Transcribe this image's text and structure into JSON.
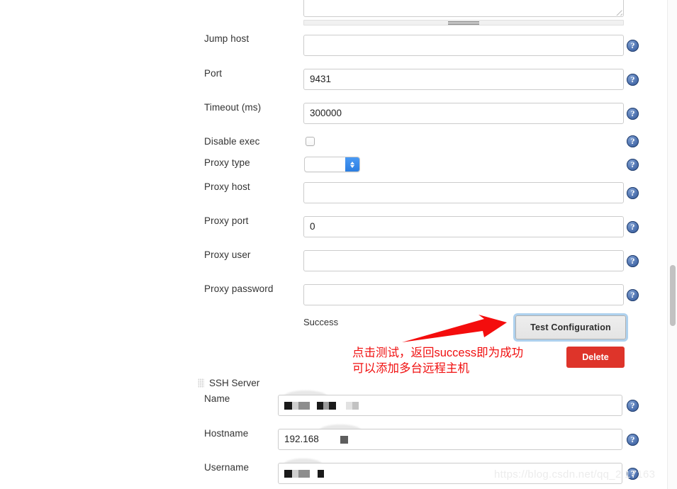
{
  "form": {
    "rows": [
      {
        "label": "Jump host",
        "value": "",
        "type": "text"
      },
      {
        "label": "Port",
        "value": "9431",
        "type": "text"
      },
      {
        "label": "Timeout (ms)",
        "value": "300000",
        "type": "text"
      },
      {
        "label": "Disable exec",
        "value": "",
        "type": "checkbox",
        "checked": false
      },
      {
        "label": "Proxy type",
        "value": "",
        "type": "select"
      },
      {
        "label": "Proxy host",
        "value": "",
        "type": "text"
      },
      {
        "label": "Proxy port",
        "value": "0",
        "type": "text"
      },
      {
        "label": "Proxy user",
        "value": "",
        "type": "text"
      },
      {
        "label": "Proxy password",
        "value": "",
        "type": "text"
      }
    ],
    "help_icon": "?",
    "help_icon_name": "help-question-icon"
  },
  "test_section": {
    "status_text": "Success",
    "test_button_label": "Test Configuration",
    "delete_button_label": "Delete"
  },
  "annotation": {
    "line1": "点击测试，返回success即为成功",
    "line2": "可以添加多台远程主机",
    "color": "#f01010"
  },
  "ssh_server": {
    "group_title": "SSH Server",
    "rows": [
      {
        "label": "Name",
        "value": ""
      },
      {
        "label": "Hostname",
        "value": "192.168"
      },
      {
        "label": "Username",
        "value": ""
      }
    ]
  },
  "watermark": {
    "text": "https://blog.csdn.net/qq_2    17163"
  },
  "colors": {
    "accent_blue": "#2b7de0",
    "focus_ring": "#aed1ee",
    "delete_red": "#de342a",
    "annotation_red": "#f01010",
    "help_blue": "#2f5391"
  }
}
